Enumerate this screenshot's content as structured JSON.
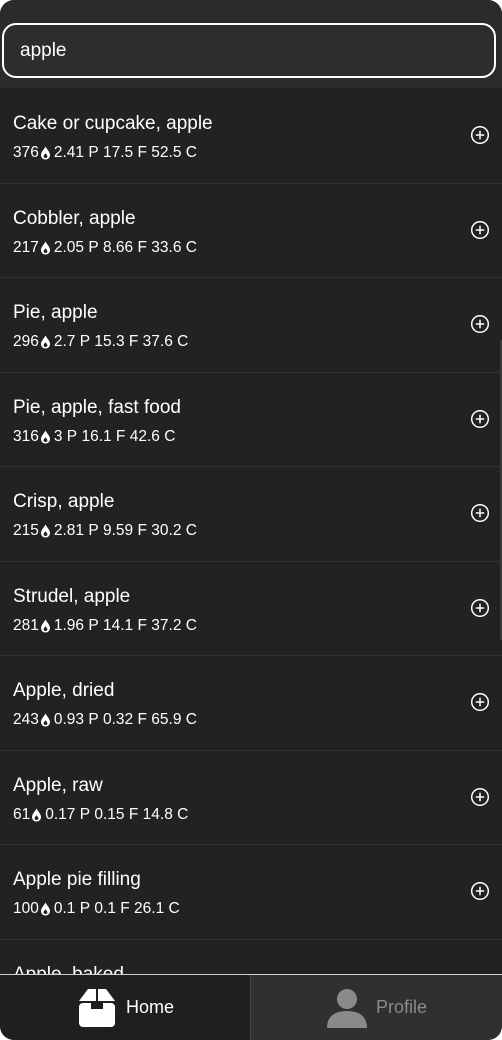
{
  "search": {
    "value": "apple"
  },
  "colors": {
    "background": "#212121",
    "row_border": "#333333",
    "text": "#ffffff",
    "inactive_text": "#8a8a8a"
  },
  "results": [
    {
      "name": "Cake or cupcake, apple",
      "calories": "376",
      "protein": "2.41 P",
      "fat": "17.5 F",
      "carbs": "52.5 C"
    },
    {
      "name": "Cobbler, apple",
      "calories": "217",
      "protein": "2.05 P",
      "fat": "8.66 F",
      "carbs": "33.6 C"
    },
    {
      "name": "Pie, apple",
      "calories": "296",
      "protein": "2.7 P",
      "fat": "15.3 F",
      "carbs": "37.6 C"
    },
    {
      "name": "Pie, apple, fast food",
      "calories": "316",
      "protein": "3 P",
      "fat": "16.1 F",
      "carbs": "42.6 C"
    },
    {
      "name": "Crisp, apple",
      "calories": "215",
      "protein": "2.81 P",
      "fat": "9.59 F",
      "carbs": "30.2 C"
    },
    {
      "name": "Strudel, apple",
      "calories": "281",
      "protein": "1.96 P",
      "fat": "14.1 F",
      "carbs": "37.2 C"
    },
    {
      "name": "Apple, dried",
      "calories": "243",
      "protein": "0.93 P",
      "fat": "0.32 F",
      "carbs": "65.9 C"
    },
    {
      "name": "Apple, raw",
      "calories": "61",
      "protein": "0.17 P",
      "fat": "0.15 F",
      "carbs": "14.8 C"
    },
    {
      "name": "Apple pie filling",
      "calories": "100",
      "protein": "0.1 P",
      "fat": "0.1 F",
      "carbs": "26.1 C"
    },
    {
      "name": "Apple, baked",
      "calories": "",
      "protein": "",
      "fat": "",
      "carbs": ""
    }
  ],
  "icons": {
    "calorie": "flame-icon",
    "add": "add-circle-icon",
    "home": "box-icon",
    "profile": "person-icon"
  },
  "nav": {
    "home_label": "Home",
    "profile_label": "Profile",
    "active": "Home"
  }
}
